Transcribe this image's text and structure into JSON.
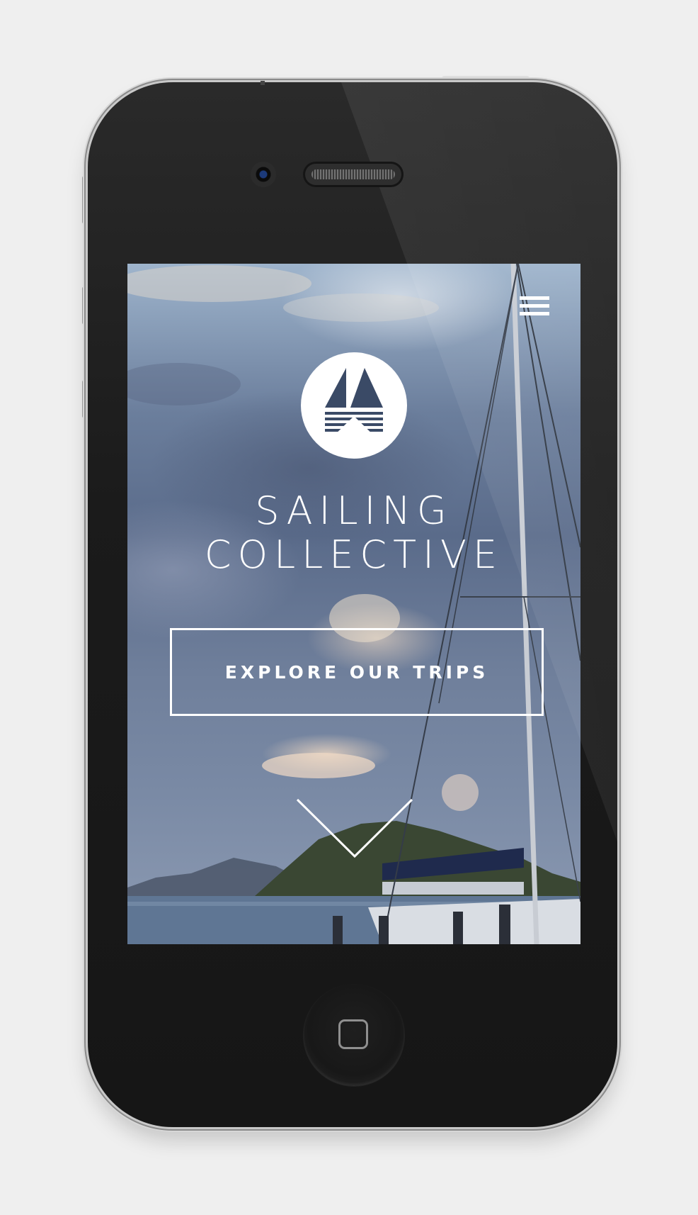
{
  "site": {
    "brand_line_1": "SAILING",
    "brand_line_2": "COLLECTIVE",
    "cta_label": "EXPLORE OUR TRIPS",
    "menu_icon": "hamburger-menu-icon",
    "logo_icon": "sailboat-logo-icon",
    "scroll_icon": "chevron-down-icon"
  },
  "device": {
    "type": "iPhone",
    "home_icon": "home-square-icon"
  },
  "colors": {
    "page_background": "#efefef",
    "phone_body": "#1b1b1b",
    "overlay_text": "#ffffff"
  }
}
